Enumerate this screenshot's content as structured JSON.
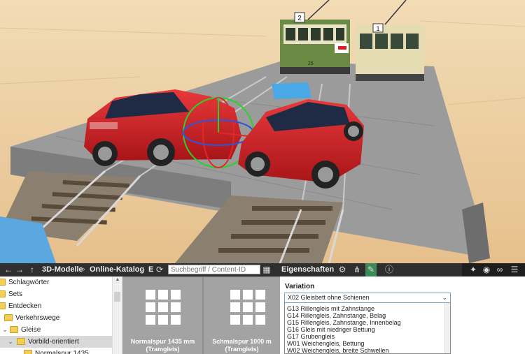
{
  "toolbar": {
    "tab_3d_models": "3D-Modelle",
    "tab_online_catalog": "Online-Katalog",
    "tab_overflow": "E",
    "search_placeholder": "Suchbegriff / Content-ID",
    "properties_label": "Eigenschaften"
  },
  "tree": {
    "items": [
      {
        "label": "Schlagwörter"
      },
      {
        "label": "Sets"
      },
      {
        "label": "Entdecken"
      },
      {
        "label": "Verkehrswege"
      },
      {
        "label": "Gleise"
      },
      {
        "label": "Vorbild-orientiert"
      },
      {
        "label": "Normalspur 1435"
      }
    ]
  },
  "cards": [
    {
      "label": "Normalspur 1435 mm",
      "sub": "(Tramgleis)"
    },
    {
      "label": "Schmalspur 1000 m",
      "sub": "(Tramgleis)"
    }
  ],
  "variation": {
    "title": "Variation",
    "selected": "X02 Gleisbett ohne Schienen",
    "options": [
      "G13 Rillengleis mit Zahnstange",
      "G14 Rillengleis, Zahnstange, Belag",
      "G15 Rillengleis, Zahnstange, Innenbelag",
      "G16 Gleis mit niedriger Bettung",
      "G17 Grubengleis",
      "W01 Weichengleis, Bettung",
      "W02 Weichengleis, breite Schwellen"
    ]
  },
  "scene": {
    "tram_left_number": "2",
    "tram_left_fleet": "25",
    "tram_right_number": "1"
  },
  "colors": {
    "toolbar_bg": "#2f2f2f",
    "accent_tab": "#3b8a5a",
    "sand": "#e8c898",
    "car_red": "#cc1e22",
    "tram_green": "#5f7f3c",
    "tram_cream": "#e6dcb4"
  },
  "icons": [
    "back-arrow-icon",
    "forward-arrow-icon",
    "up-arrow-icon",
    "refresh-icon",
    "grid-view-icon",
    "gear-icon",
    "hierarchy-icon",
    "paint-brush-icon",
    "info-icon",
    "pin-icon",
    "eye-icon",
    "link-icon",
    "menu-icon",
    "folder-icon"
  ]
}
